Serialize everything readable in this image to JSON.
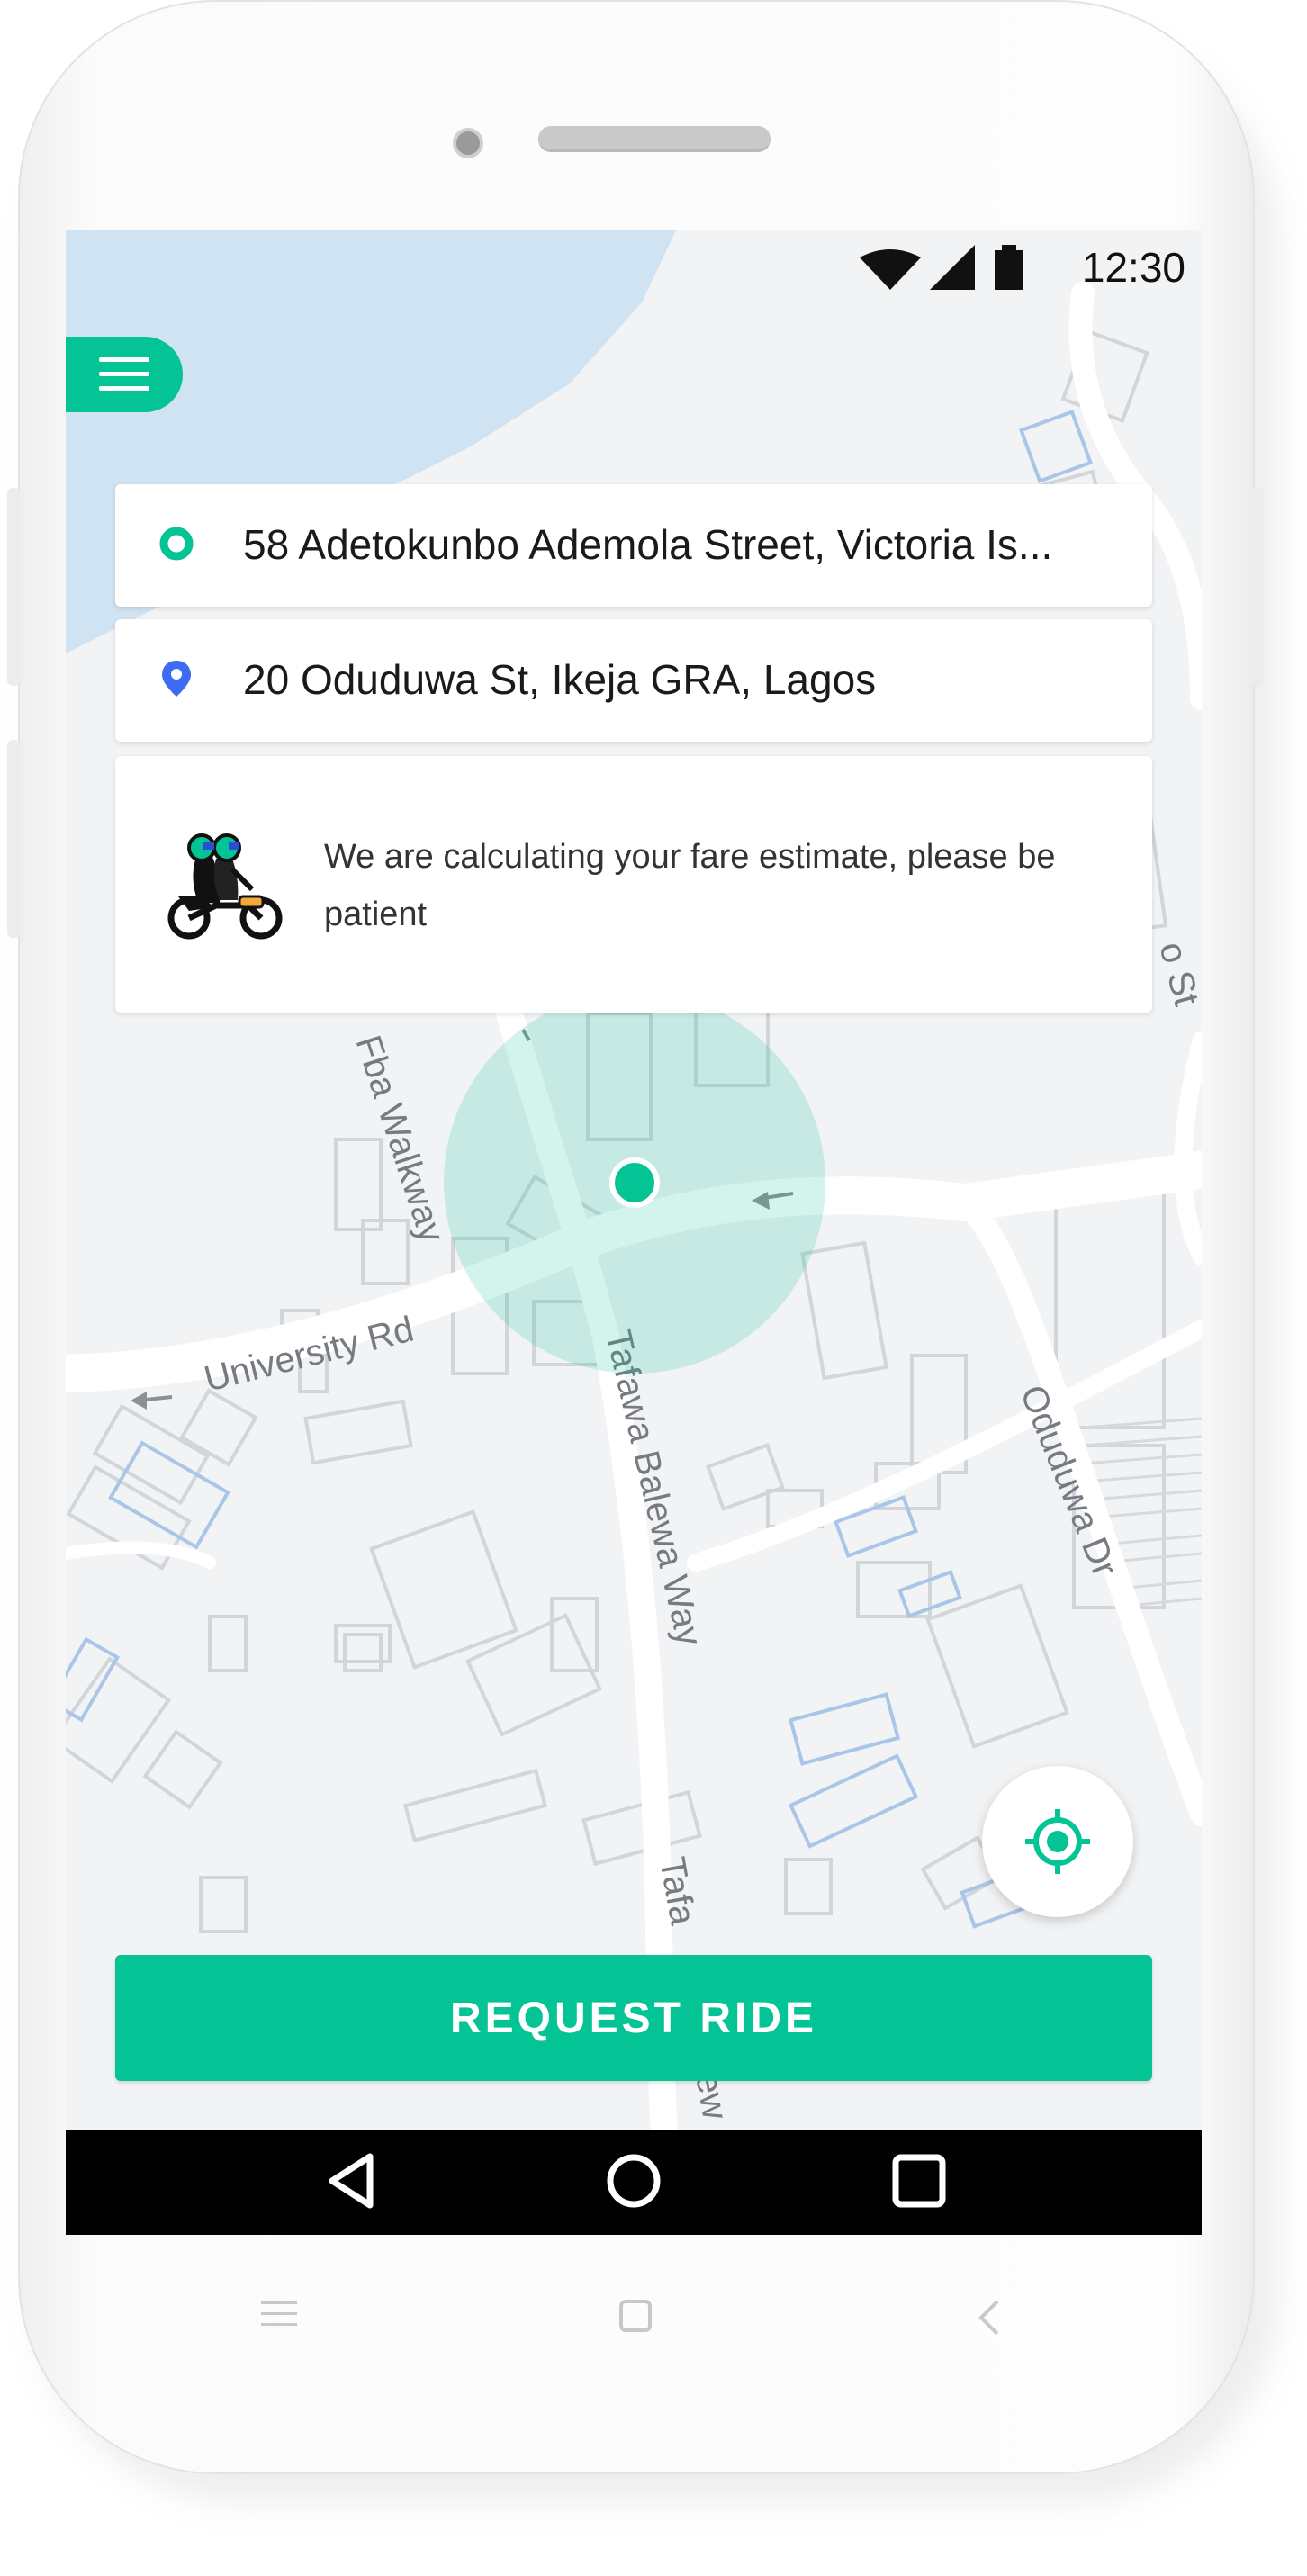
{
  "status_bar": {
    "time": "12:30",
    "icons": [
      "wifi-icon",
      "signal-icon",
      "battery-icon"
    ]
  },
  "menu": {
    "icon": "hamburger-menu-icon"
  },
  "pickup": {
    "address": "58 Adetokunbo Ademola Street, Victoria Is...",
    "icon": "origin-dot-icon",
    "icon_color": "#04c495"
  },
  "destination": {
    "address": "20 Oduduwa St, Ikeja GRA, Lagos",
    "icon": "destination-pin-icon",
    "icon_color": "#3d6bf2"
  },
  "fare": {
    "message": "We are calculating your fare estimate, please be patient",
    "icon": "motorbike-riders-icon"
  },
  "map": {
    "street_labels": [
      "Fba Walkway",
      "University Rd",
      "Tafawa Balewa Way",
      "Oduduwa Dr",
      "Tafa",
      "ew",
      "o St"
    ]
  },
  "request_button": {
    "label": "REQUEST RIDE"
  },
  "locate": {
    "icon": "locate-crosshair-icon"
  },
  "nav_bar": {
    "icons": [
      "back-triangle-icon",
      "home-circle-icon",
      "recents-square-icon"
    ]
  },
  "hardware_keys": {
    "icons": [
      "menu-lines-icon",
      "home-square-icon",
      "back-chevron-icon"
    ]
  },
  "colors": {
    "accent": "#04c495",
    "map_bg": "#f1f3f5",
    "water": "#cfe3f3",
    "road": "#ffffff"
  }
}
